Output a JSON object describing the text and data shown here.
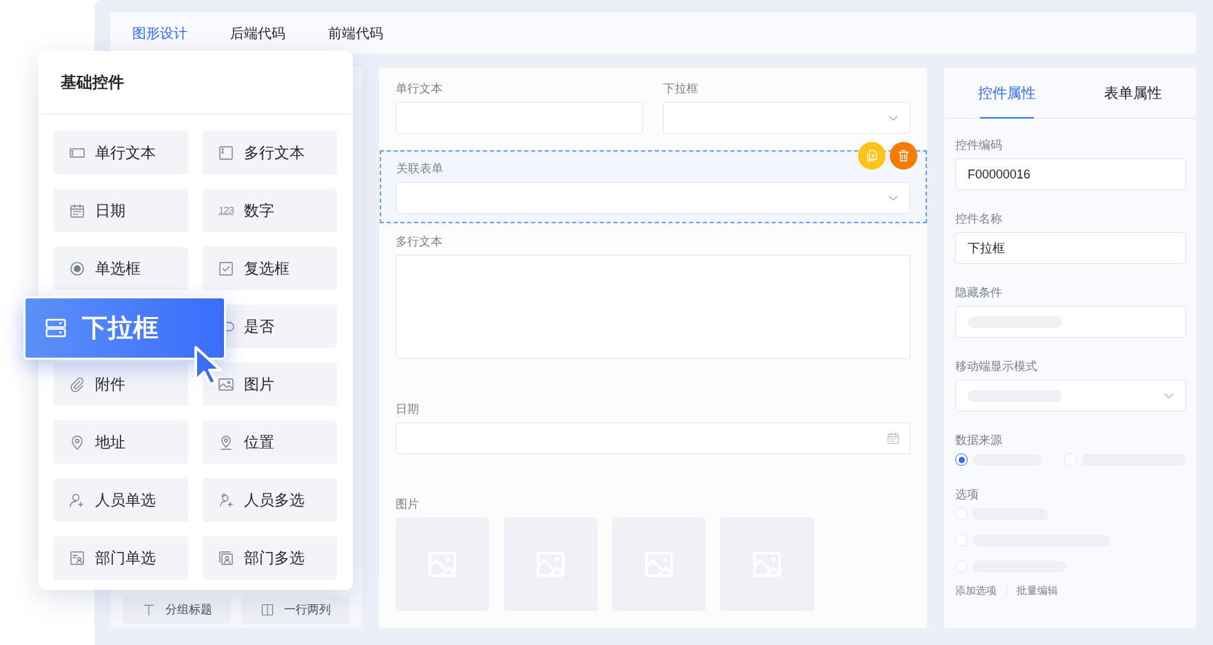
{
  "top_tabs": [
    {
      "label": "图形设计",
      "selected": true
    },
    {
      "label": "后端代码",
      "selected": false
    },
    {
      "label": "前端代码",
      "selected": false
    }
  ],
  "palette": {
    "title": "基础控件",
    "items": [
      {
        "label": "单行文本"
      },
      {
        "label": "多行文本"
      },
      {
        "label": "日期"
      },
      {
        "label": "数字",
        "icon_text": "123"
      },
      {
        "label": "单选框"
      },
      {
        "label": "复选框"
      },
      {
        "label": "是否"
      },
      {
        "label": "附件"
      },
      {
        "label": "图片"
      },
      {
        "label": "地址"
      },
      {
        "label": "位置"
      },
      {
        "label": "人员单选"
      },
      {
        "label": "人员多选"
      },
      {
        "label": "部门单选"
      },
      {
        "label": "部门多选"
      }
    ]
  },
  "dragged_control": {
    "label": "下拉框"
  },
  "left_panel": {
    "buttons": [
      "分组标题",
      "一行两列"
    ]
  },
  "form": {
    "rows": [
      [
        {
          "label": "单行文本",
          "kind": "input",
          "selected": false
        },
        {
          "label": "下拉框",
          "kind": "select",
          "selected": false
        }
      ],
      [
        {
          "label": "关联表单",
          "kind": "select",
          "selected": true
        }
      ],
      [
        {
          "label": "多行文本",
          "kind": "textarea",
          "selected": false
        }
      ],
      [
        {
          "label": "日期",
          "kind": "date",
          "selected": false
        }
      ],
      [
        {
          "label": "图片",
          "kind": "images",
          "selected": false,
          "tiles": [
            {
              "kind": "placeholder"
            },
            {
              "kind": "placeholder"
            },
            {
              "kind": "placeholder"
            },
            {
              "kind": "placeholder"
            }
          ]
        }
      ]
    ]
  },
  "properties": {
    "tabs": [
      {
        "label": "控件属性",
        "selected": true
      },
      {
        "label": "表单属性",
        "selected": false
      }
    ],
    "fields": [
      {
        "label": "控件编码",
        "kind": "text",
        "value": "F00000016"
      },
      {
        "label": "控件名称",
        "kind": "text",
        "value": "下拉框"
      },
      {
        "label": "隐藏条件",
        "kind": "skeleton"
      },
      {
        "label": "移动端显示模式",
        "kind": "skeleton-select"
      },
      {
        "label": "数据来源",
        "kind": "radio-row",
        "options": [
          {
            "selected": true
          },
          {
            "selected": false
          }
        ]
      },
      {
        "label": "选项",
        "kind": "radio-list",
        "options": [
          {
            "selected": false
          },
          {
            "selected": false
          },
          {
            "selected": false
          }
        ]
      }
    ],
    "links": [
      "添加选项",
      "批量编辑"
    ]
  }
}
